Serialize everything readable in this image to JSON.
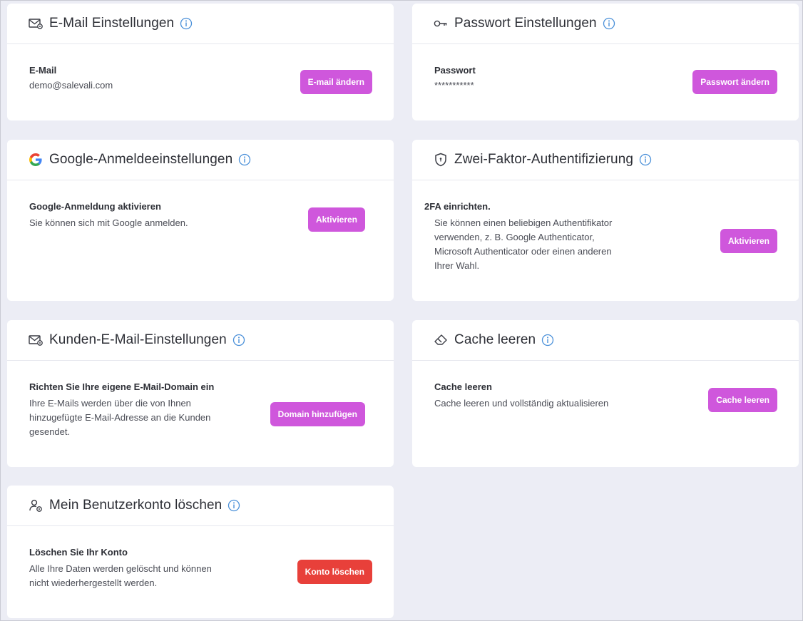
{
  "email_settings": {
    "title": "E-Mail Einstellungen",
    "field_label": "E-Mail",
    "field_value": "demo@salevali.com",
    "button": "E-mail ändern"
  },
  "password_settings": {
    "title": "Passwort Einstellungen",
    "field_label": "Passwort",
    "field_value": "***********",
    "button": "Passwort ändern"
  },
  "google_settings": {
    "title": "Google-Anmeldeeinstellungen",
    "field_label": "Google-Anmeldung aktivieren",
    "description": "Sie können sich mit Google anmelden.",
    "button": "Aktivieren"
  },
  "two_factor": {
    "title": "Zwei-Faktor-Authentifizierung",
    "field_label": "2FA einrichten.",
    "description_lines": [
      "Sie können einen beliebigen Authentifikator",
      "verwenden, z. B. Google Authenticator,",
      "Microsoft Authenticator oder einen anderen",
      "Ihrer Wahl."
    ],
    "button": "Aktivieren"
  },
  "customer_email": {
    "title": "Kunden-E-Mail-Einstellungen",
    "field_label": "Richten Sie Ihre eigene E-Mail-Domain ein",
    "description_lines": [
      "Ihre E-Mails werden über die von Ihnen",
      "hinzugefügte E-Mail-Adresse an die Kunden",
      "gesendet."
    ],
    "button": "Domain hinzufügen"
  },
  "cache": {
    "title": "Cache leeren",
    "field_label": "Cache leeren",
    "description": "Cache leeren und vollständig aktualisieren",
    "button": "Cache leeren"
  },
  "delete_account": {
    "title": "Mein Benutzerkonto löschen",
    "field_label": "Löschen Sie Ihr Konto",
    "description_lines": [
      "Alle Ihre Daten werden gelöscht und können",
      "nicht wiederhergestellt werden."
    ],
    "button": "Konto löschen"
  },
  "colors": {
    "primary_button": "#cf57dc",
    "danger_button": "#e8403a",
    "info_icon": "#4a90d9",
    "background": "#ecedf5"
  },
  "icons": {
    "email_settings": "envelope-gear-icon",
    "password_settings": "key-icon",
    "google_settings": "google-logo-icon",
    "two_factor": "shield-icon",
    "customer_email": "envelope-gear-icon",
    "cache": "eraser-icon",
    "delete_account": "user-gear-icon",
    "info": "info-icon"
  }
}
